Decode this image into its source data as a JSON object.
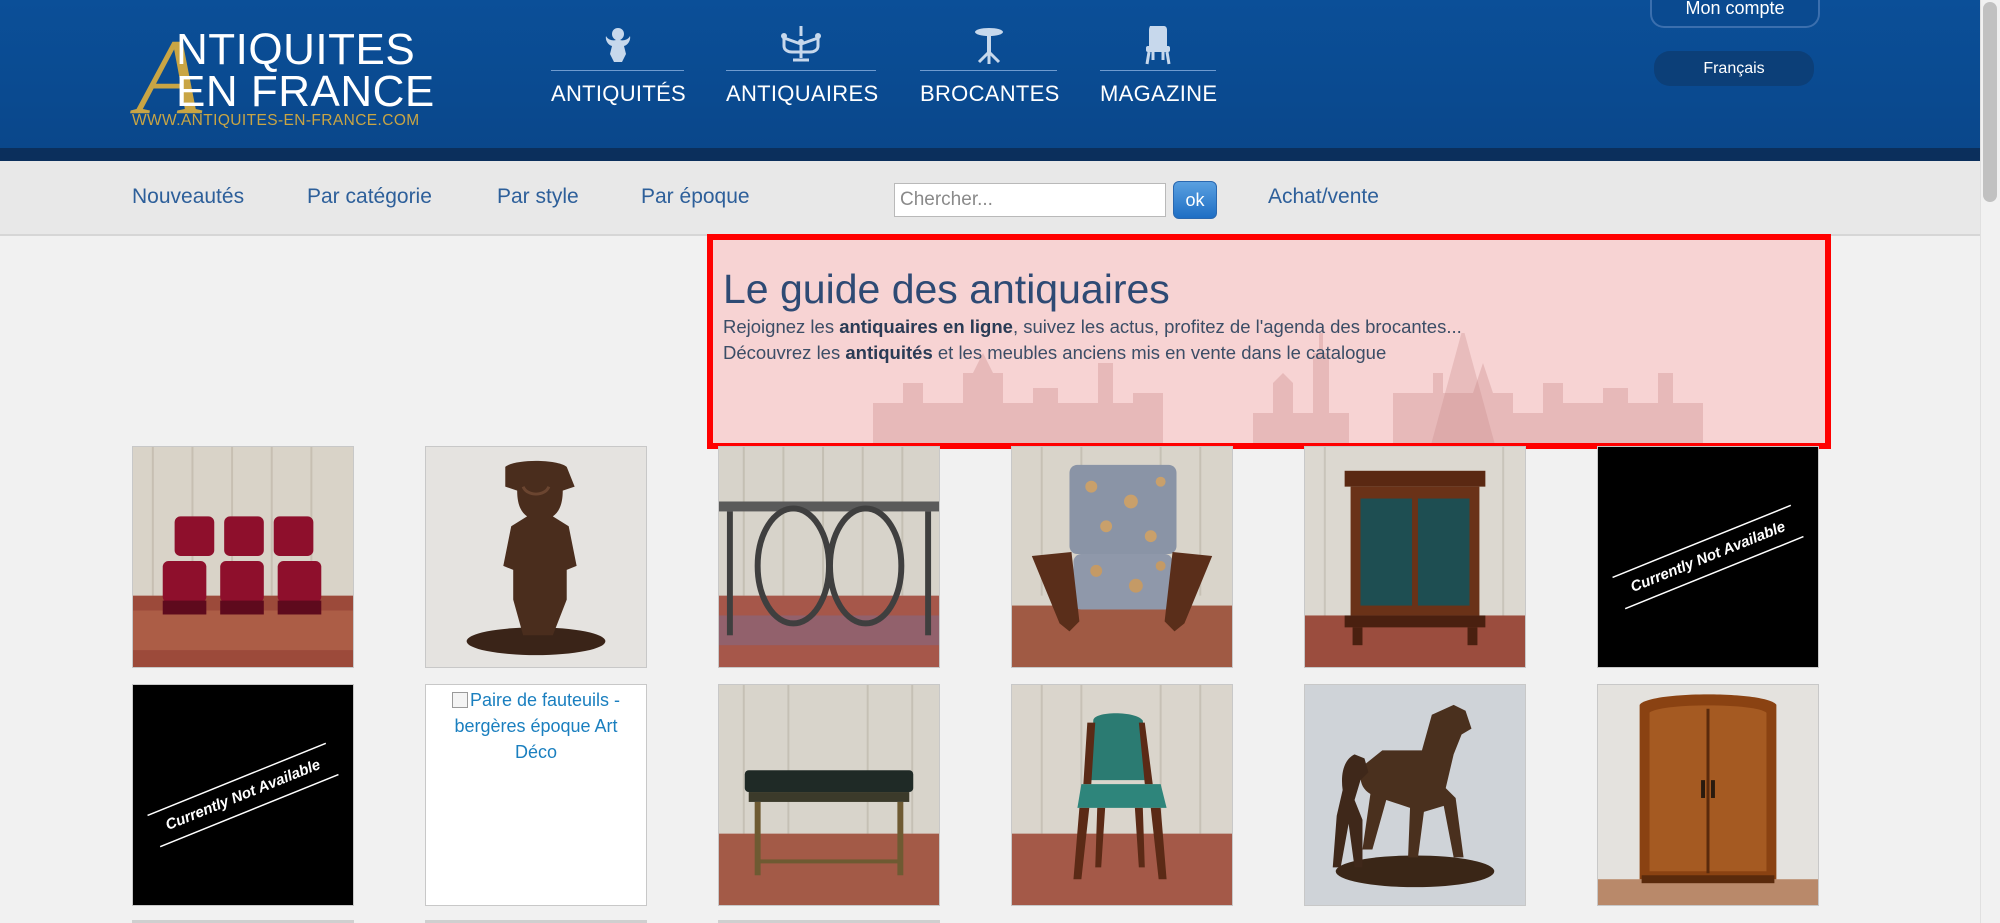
{
  "logo": {
    "line1": "NTIQUITES",
    "line2": "EN FRANCE",
    "big_letter": "A",
    "url": "WWW.ANTIQUITES-EN-FRANCE.COM"
  },
  "main_nav": [
    {
      "label": "ANTIQUITÉS",
      "icon": "cherub-icon"
    },
    {
      "label": "ANTIQUAIRES",
      "icon": "chandelier-icon"
    },
    {
      "label": "BROCANTES",
      "icon": "pedestal-table-icon"
    },
    {
      "label": "MAGAZINE",
      "icon": "chair-icon"
    }
  ],
  "account": {
    "label": "Mon compte"
  },
  "language": {
    "label": "Français"
  },
  "subnav": {
    "links": [
      "Nouveautés",
      "Par catégorie",
      "Par style",
      "Par époque"
    ],
    "search_placeholder": "Chercher...",
    "search_button": "ok",
    "achat_vente": "Achat/vente"
  },
  "guide": {
    "title": "Le guide des antiquaires",
    "line1_pre": "Rejoignez les ",
    "line1_bold": "antiquaires en ligne",
    "line1_post": ", suivez les actus, profitez de l'agenda des brocantes...",
    "line2_pre": "Découvrez les ",
    "line2_bold": "antiquités",
    "line2_post": " et les meubles anciens mis en vente dans le catalogue"
  },
  "products": [
    {
      "kind": "chairs-red"
    },
    {
      "kind": "bronze-statue"
    },
    {
      "kind": "console-table"
    },
    {
      "kind": "armchair-floral"
    },
    {
      "kind": "bookcase"
    },
    {
      "kind": "not-available",
      "badge": "Currently Not Available"
    },
    {
      "kind": "not-available",
      "badge": "Currently Not Available"
    },
    {
      "kind": "broken",
      "alt": "Paire de fauteuils - bergères époque Art Déco"
    },
    {
      "kind": "side-table"
    },
    {
      "kind": "chair-green"
    },
    {
      "kind": "horses-bronze"
    },
    {
      "kind": "armoire"
    }
  ],
  "colors": {
    "header_blue": "#0b4f98",
    "gold": "#c9a544",
    "link_blue": "#2d5f9a",
    "highlight_red": "#ff0000"
  }
}
